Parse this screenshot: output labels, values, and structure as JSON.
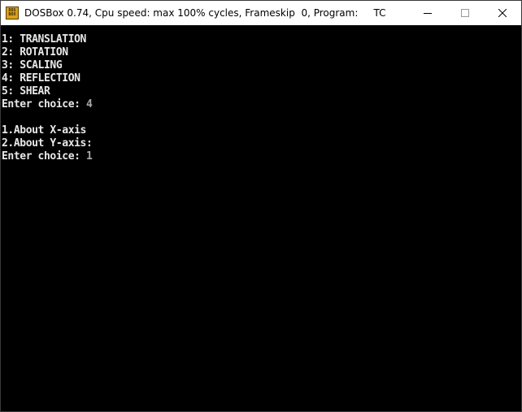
{
  "window": {
    "title": "DOSBox 0.74, Cpu speed: max 100% cycles, Frameskip  0, Program:     TC",
    "icon_name": "dosbox-icon",
    "icon_lines": [
      "DOS",
      "BOX"
    ],
    "controls": [
      "minimize-icon",
      "maximize-icon",
      "close-icon"
    ]
  },
  "console": {
    "menu": [
      "1: TRANSLATION",
      "2: ROTATION",
      "3: SCALING",
      "4: REFLECTION",
      "5: SHEAR"
    ],
    "prompt1": {
      "label": "Enter choice: ",
      "value": "4"
    },
    "submenu": [
      "1.About X-axis",
      "2.About Y-axis:"
    ],
    "prompt2": {
      "label": "Enter choice: ",
      "value": "1"
    }
  },
  "colors": {
    "background": "#000000",
    "text": "#e8e8e8",
    "input_text": "#a8a8a8",
    "titlebar": "#ffffff"
  }
}
